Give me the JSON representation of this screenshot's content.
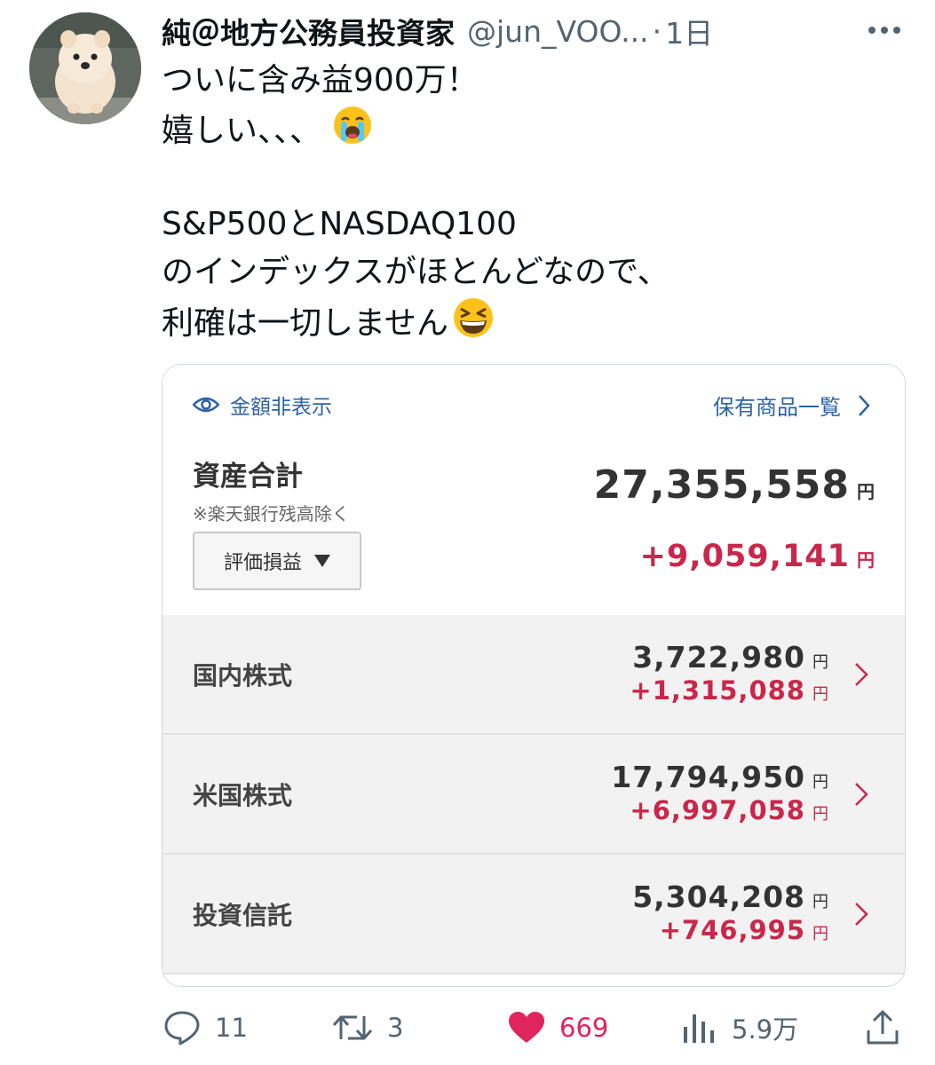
{
  "tweet": {
    "display_name": "純＠地方公務員投資家",
    "handle": "@jun_VOO...",
    "separator": "·",
    "time": "1日",
    "lines": [
      "ついに含み益900万！",
      "嬉しい、、、",
      "",
      "S&P500とNASDAQ100",
      "のインデックスがほとんどなので、",
      "利確は一切しません"
    ],
    "emojis": [
      "loudly-crying-face",
      "grinning-squinting-face"
    ]
  },
  "card": {
    "hide_amount_label": "金額非表示",
    "holdings_link_label": "保有商品一覧",
    "total_label": "資産合計",
    "total_note": "※楽天銀行残高除く",
    "total_value": "27,355,558",
    "total_gain": "+9,059,141",
    "yen": "円",
    "select": {
      "selected": "評価損益"
    },
    "rows": [
      {
        "label": "国内株式",
        "value": "3,722,980",
        "gain": "+1,315,088"
      },
      {
        "label": "米国株式",
        "value": "17,794,950",
        "gain": "+6,997,058"
      },
      {
        "label": "投資信託",
        "value": "5,304,208",
        "gain": "+746,995"
      }
    ],
    "colors": {
      "link": "#2d63a8",
      "gain": "#c9274b"
    }
  },
  "actions": {
    "replies": "11",
    "retweets": "3",
    "likes": "669",
    "views": "5.9万"
  }
}
